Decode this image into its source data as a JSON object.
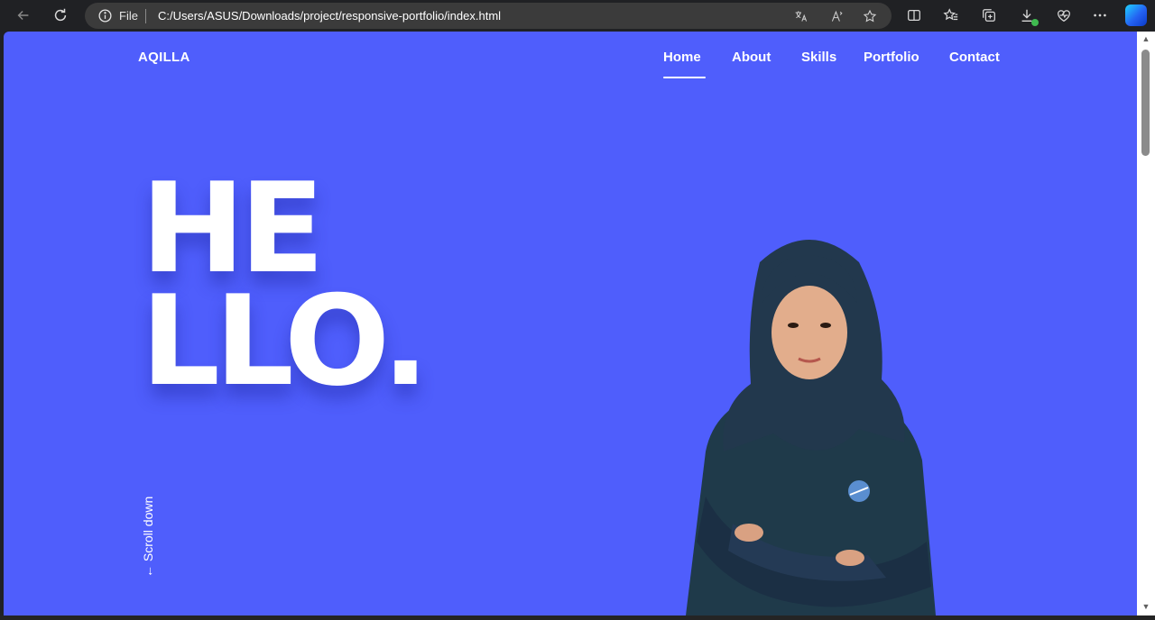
{
  "browser": {
    "scheme_label": "File",
    "url": "C:/Users/ASUS/Downloads/project/responsive-portfolio/index.html"
  },
  "site": {
    "logo": "AQILLA",
    "nav": [
      "Home",
      "About",
      "Skills",
      "Portfolio",
      "Contact"
    ],
    "active_nav": "Home",
    "hero_line1": "HE",
    "hero_line2": "LLO.",
    "scroll_label": "Scroll down",
    "accent_color": "#4f5efc"
  }
}
